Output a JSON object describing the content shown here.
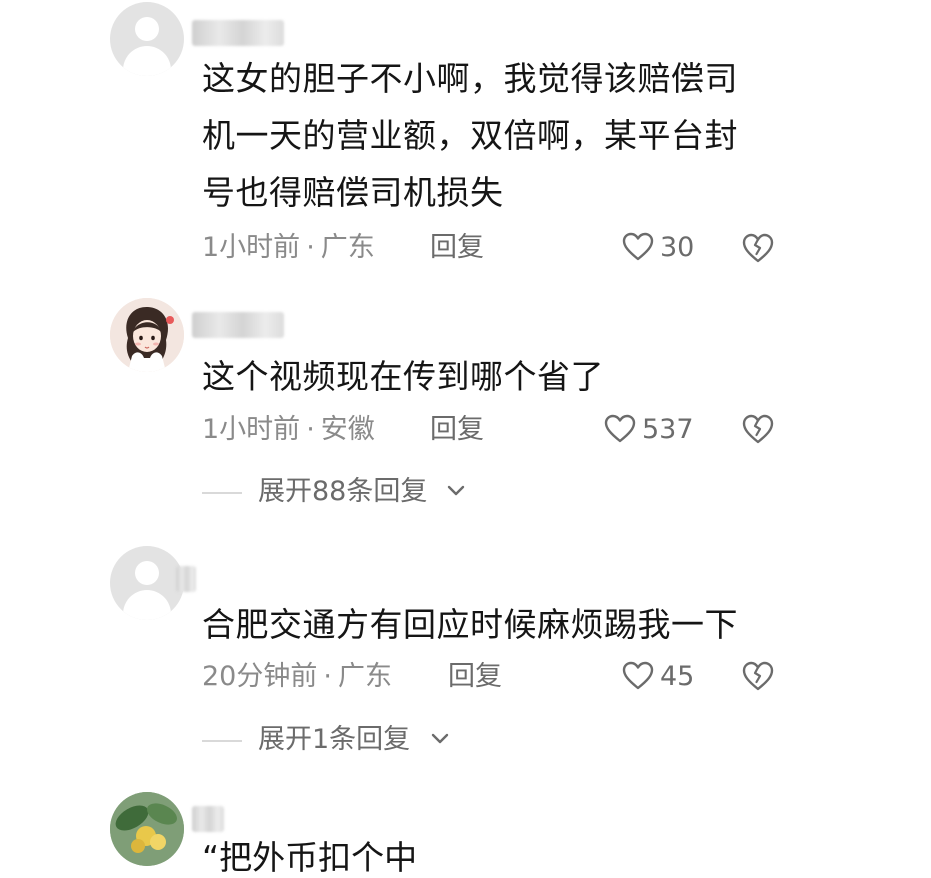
{
  "comments": [
    {
      "text_lines": [
        "这女的胆子不小啊，我觉得该赔偿司",
        "机一天的营业额，双倍啊，某平台封",
        "号也得赔偿司机损失"
      ],
      "time": "1小时前",
      "location": "广东",
      "reply_label": "回复",
      "likes": "30",
      "avatar": "default-avatar-icon"
    },
    {
      "text_lines": [
        "这个视频现在传到哪个省了"
      ],
      "time": "1小时前",
      "location": "安徽",
      "reply_label": "回复",
      "likes": "537",
      "expand_label": "展开88条回复",
      "avatar": "illustrated-girl-avatar"
    },
    {
      "text_lines": [
        "合肥交通方有回应时候麻烦踢我一下"
      ],
      "time": "20分钟前",
      "location": "广东",
      "reply_label": "回复",
      "likes": "45",
      "expand_label": "展开1条回复",
      "avatar": "default-avatar-icon"
    },
    {
      "text_lines": [
        "“把外币扣个中"
      ],
      "avatar": "leaf-photo-avatar"
    }
  ],
  "colors": {
    "text": "#151515",
    "meta": "#8a8a8a",
    "secondary": "#6b6b6b",
    "avatar_bg": "#e3e3e3"
  }
}
